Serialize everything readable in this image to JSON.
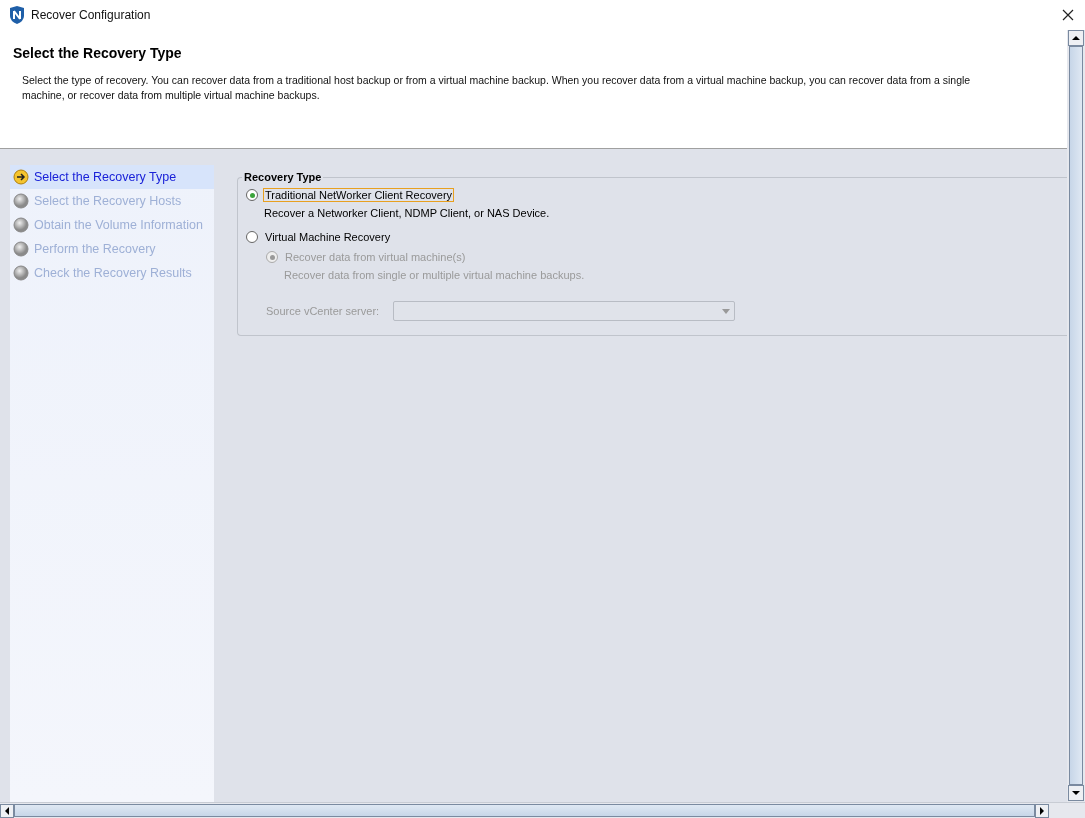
{
  "window": {
    "title": "Recover Configuration"
  },
  "header": {
    "title": "Select the Recovery Type",
    "description": "Select the type of recovery. You can recover data from a traditional host backup or from a virtual machine backup.  When you recover data from a virtual machine backup, you can recover data from a single machine, or recover data from multiple virtual machine backups."
  },
  "steps": [
    {
      "label": "Select the Recovery Type",
      "selected": true
    },
    {
      "label": "Select the Recovery Hosts",
      "selected": false
    },
    {
      "label": "Obtain the Volume Information",
      "selected": false
    },
    {
      "label": "Perform the Recovery",
      "selected": false
    },
    {
      "label": "Check the Recovery Results",
      "selected": false
    }
  ],
  "recovery_type": {
    "legend": "Recovery Type",
    "options": [
      {
        "label": "Traditional NetWorker Client Recovery",
        "description": "Recover a Networker Client, NDMP Client, or NAS Device.",
        "selected": true,
        "focused": true
      },
      {
        "label": "Virtual Machine Recovery",
        "selected": false,
        "focused": false
      }
    ],
    "vm_option": {
      "label": "Recover data from virtual machine(s)",
      "description": "Recover data from single or multiple virtual machine backups.",
      "selected": true,
      "disabled": true
    },
    "source_vcenter": {
      "label": "Source vCenter server:",
      "disabled": true
    }
  }
}
